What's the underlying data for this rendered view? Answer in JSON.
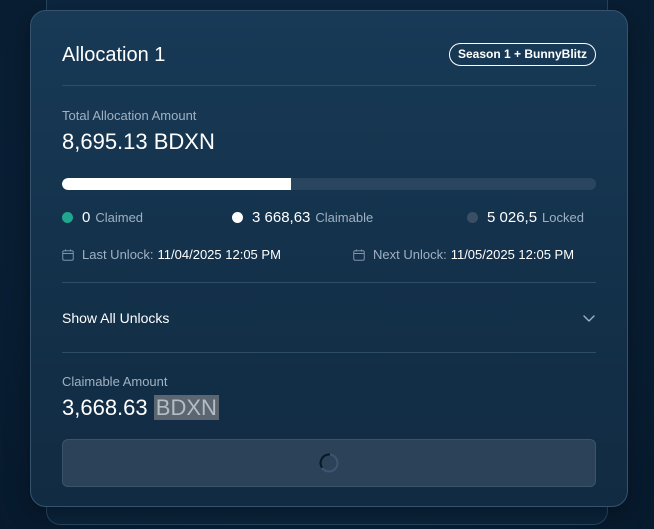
{
  "allocation": {
    "title": "Allocation 1",
    "badge": "Season 1 + BunnyBlitz",
    "total_label": "Total Allocation Amount",
    "total_amount": "8,695.13 BDXN",
    "progress_fraction": 0.428
  },
  "legend": {
    "claimed_value": "0",
    "claimed_label": "Claimed",
    "claimable_value": "3 668,63",
    "claimable_label": "Claimable",
    "locked_value": "5 026,5",
    "locked_label": "Locked"
  },
  "unlocks": {
    "last_label": "Last Unlock:",
    "last_value": "11/04/2025 12:05 PM",
    "next_label": "Next Unlock:",
    "next_value": "11/05/2025 12:05 PM",
    "show_all_label": "Show All Unlocks"
  },
  "claimable": {
    "label": "Claimable Amount",
    "amount": "3,668.63",
    "unit": "BDXN"
  },
  "colors": {
    "claimed_dot": "#1fa88e",
    "claimable_dot": "#ffffff",
    "locked_dot": "#3a4f64"
  },
  "icons": {
    "calendar": "calendar-icon",
    "chevron": "chevron-down-icon",
    "spinner": "loading-spinner-icon"
  }
}
